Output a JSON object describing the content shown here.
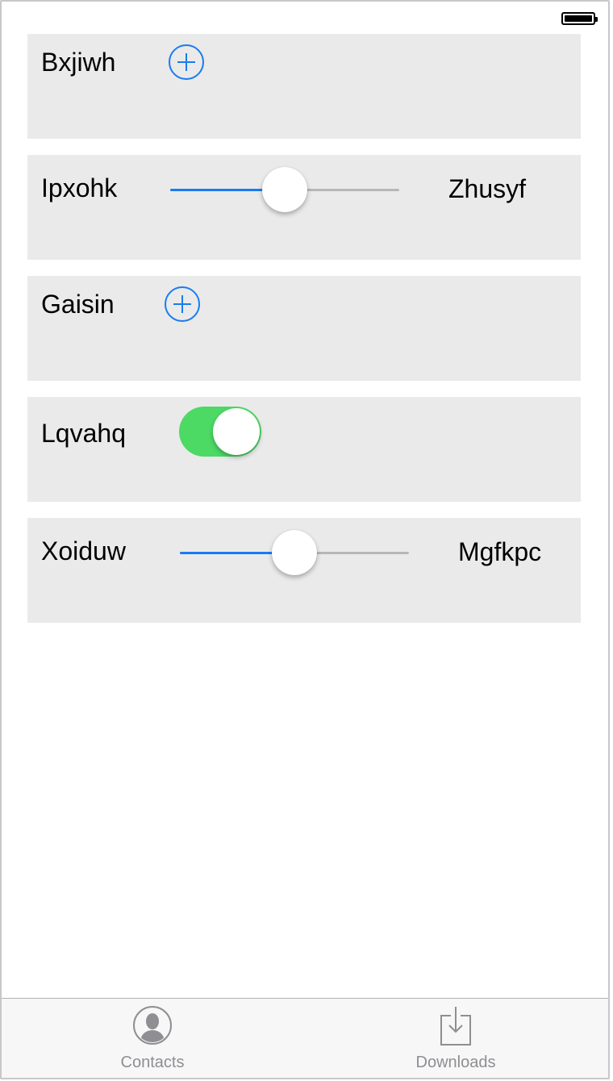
{
  "status_bar": {
    "battery_icon": "battery-full-icon"
  },
  "rows": [
    {
      "label": "Bxjiwh",
      "control": "add-button",
      "icon": "plus-circle-icon"
    },
    {
      "label": "Ipxohk",
      "control": "slider",
      "value": 0.5,
      "max_label": "Zhusyf"
    },
    {
      "label": "Gaisin",
      "control": "add-button",
      "icon": "plus-circle-icon"
    },
    {
      "label": "Lqvahq",
      "control": "switch",
      "on": true
    },
    {
      "label": "Xoiduw",
      "control": "slider",
      "value": 0.5,
      "max_label": "Mgfkpc"
    }
  ],
  "tab_bar": {
    "tabs": [
      {
        "label": "Contacts",
        "icon": "contacts-icon"
      },
      {
        "label": "Downloads",
        "icon": "downloads-icon"
      }
    ]
  },
  "colors": {
    "accent": "#1a7bf0",
    "switch_on": "#4cd964",
    "row_background": "#eaeaea",
    "tab_inactive": "#8e8e93"
  }
}
